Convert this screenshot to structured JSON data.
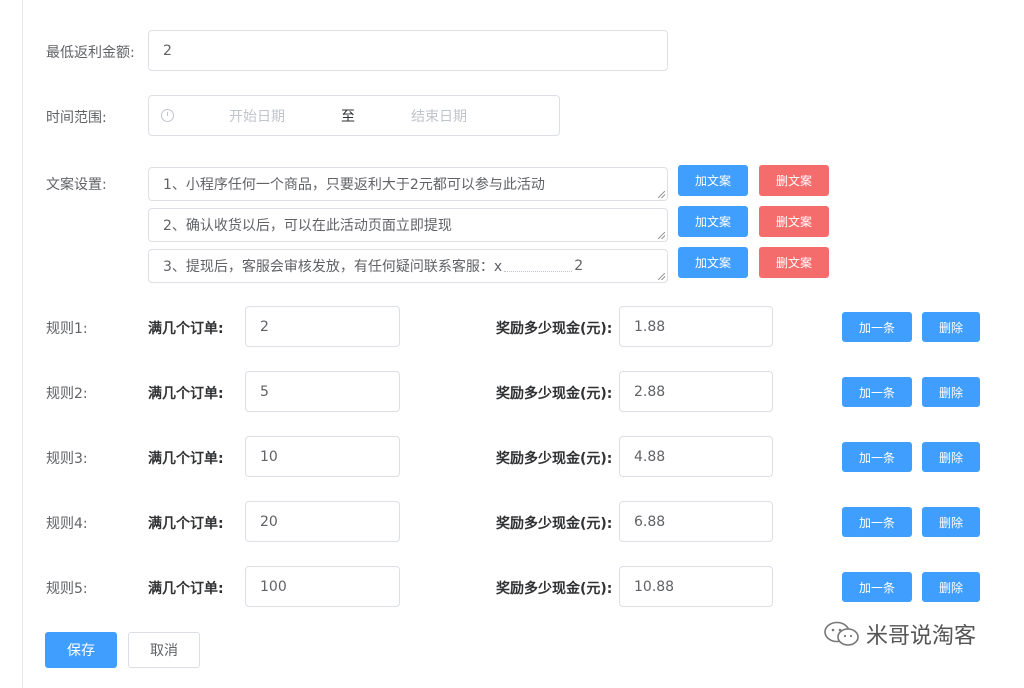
{
  "form": {
    "min_rebate_label": "最低返利金额:",
    "min_rebate_value": "2",
    "time_range_label": "时间范围:",
    "start_placeholder": "开始日期",
    "range_separator": "至",
    "end_placeholder": "结束日期",
    "copy_label": "文案设置:",
    "copy_lines": [
      {
        "text": "1、小程序任何一个商品，只要返利大于2元都可以参与此活动"
      },
      {
        "text": "2、确认收货以后，可以在此活动页面立即提现"
      },
      {
        "text": "3、提现后，客服会审核发放，有任何疑问联系客服：x",
        "suffix": "2"
      }
    ],
    "add_copy_label": "加文案",
    "delete_copy_label": "删文案",
    "order_count_label": "满几个订单:",
    "reward_label": "奖励多少现金(元):",
    "add_rule_label": "加一条",
    "delete_rule_label": "删除",
    "rules": [
      {
        "label": "规则1:",
        "orders": "2",
        "reward": "1.88"
      },
      {
        "label": "规则2:",
        "orders": "5",
        "reward": "2.88"
      },
      {
        "label": "规则3:",
        "orders": "10",
        "reward": "4.88"
      },
      {
        "label": "规则4:",
        "orders": "20",
        "reward": "6.88"
      },
      {
        "label": "规则5:",
        "orders": "100",
        "reward": "10.88"
      }
    ],
    "save_label": "保存",
    "cancel_label": "取消"
  },
  "watermark": {
    "text": "米哥说淘客",
    "icon": "wechat-icon"
  },
  "colors": {
    "primary": "#409eff",
    "danger": "#f56c6c",
    "border": "#dcdfe6",
    "text": "#606266"
  }
}
